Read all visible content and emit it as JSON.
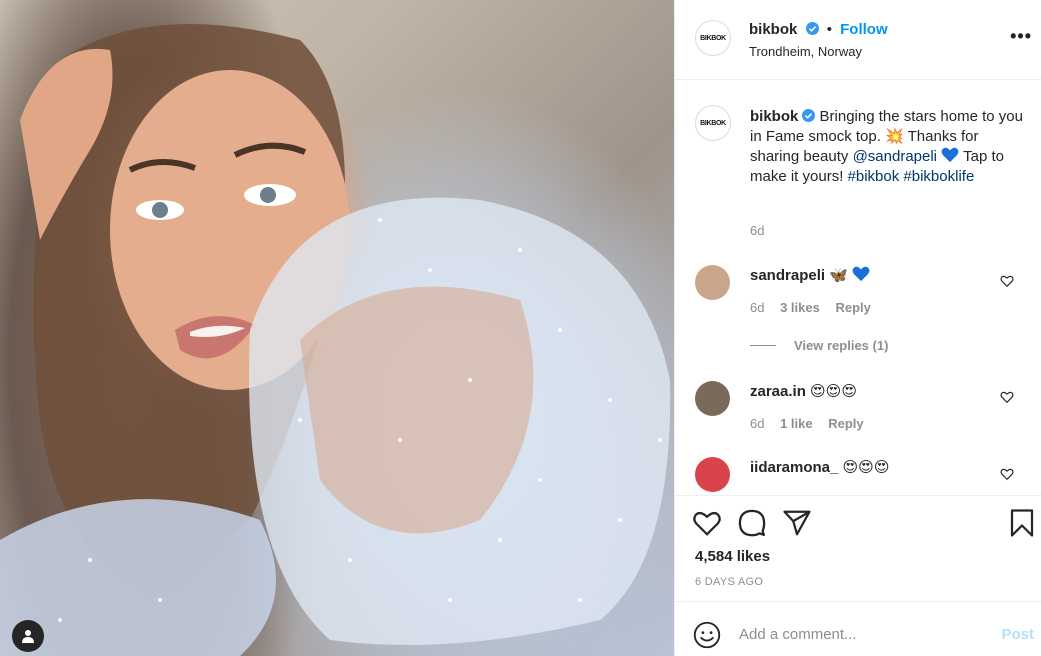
{
  "post": {
    "image_alt": "Woman in sheer star-print Fame smock top",
    "account": {
      "username": "bikbok",
      "logo_text": "BIKBOK",
      "verified": true
    },
    "header": {
      "follow_label": "Follow",
      "separator": "•",
      "location": "Trondheim, Norway"
    },
    "more_label": "•••",
    "caption": {
      "part1": "Bringing the stars home to you in Fame smock top. ",
      "emoji1": "💥",
      "part2": " Thanks for sharing beauty ",
      "mention": "@sandrapeli",
      "part3": " Tap to make it yours! ",
      "hashtag1": "#bikbok",
      "hashtag2": "#bikboklife",
      "time": "6d"
    },
    "comments": [
      {
        "username": "sandrapeli",
        "text": "🦋",
        "time": "6d",
        "likes": "3 likes",
        "reply": "Reply",
        "avatar_color": "#c9a58c"
      },
      {
        "username": "zaraa.in",
        "text": "😍😍😍",
        "time": "6d",
        "likes": "1 like",
        "reply": "Reply",
        "avatar_color": "#7a6a5c"
      },
      {
        "username": "iidaramona_",
        "text": "😍😍😍",
        "time": "",
        "likes": "",
        "reply": "",
        "avatar_color": "#d9434a"
      }
    ],
    "view_replies": "View replies (1)",
    "likes": "4,584 likes",
    "posted_ago": "6 DAYS AGO",
    "add_comment": {
      "placeholder": "Add a comment...",
      "post_label": "Post"
    },
    "colors": {
      "link": "#00376b",
      "follow": "#0095f6",
      "verified": "#3897f0",
      "heart_emoji": "#1a6fd8"
    }
  }
}
